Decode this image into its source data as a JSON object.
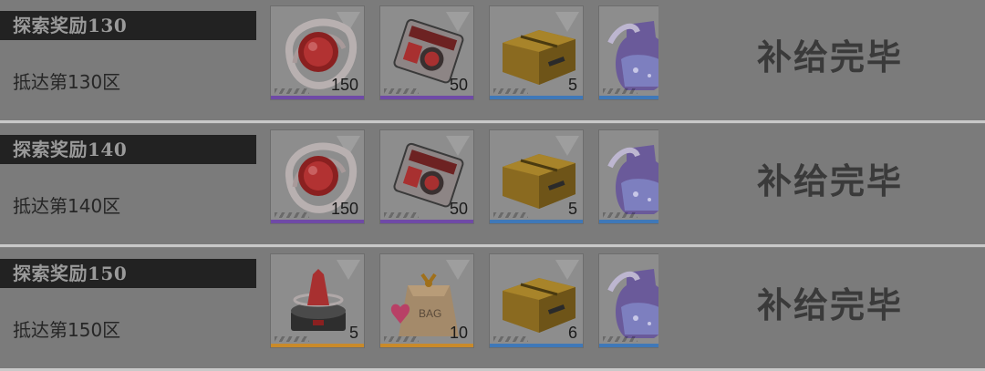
{
  "rows": [
    {
      "title": "探索奖励130",
      "subtitle": "抵达第130区",
      "status": "补给完毕",
      "items": [
        {
          "icon": "red-core-icon",
          "qty": "150",
          "rarity_color": "#6f4aa6"
        },
        {
          "icon": "red-device-icon",
          "qty": "50",
          "rarity_color": "#6f4aa6"
        },
        {
          "icon": "supply-crate-icon",
          "qty": "5",
          "rarity_color": "#3f78b8"
        },
        {
          "icon": "potion-bottle-icon",
          "qty": "",
          "rarity_color": "#3f78b8"
        }
      ]
    },
    {
      "title": "探索奖励140",
      "subtitle": "抵达第140区",
      "status": "补给完毕",
      "items": [
        {
          "icon": "red-core-icon",
          "qty": "150",
          "rarity_color": "#6f4aa6"
        },
        {
          "icon": "red-device-icon",
          "qty": "50",
          "rarity_color": "#6f4aa6"
        },
        {
          "icon": "supply-crate-icon",
          "qty": "5",
          "rarity_color": "#3f78b8"
        },
        {
          "icon": "potion-bottle-icon",
          "qty": "",
          "rarity_color": "#3f78b8"
        }
      ]
    },
    {
      "title": "探索奖励150",
      "subtitle": "抵达第150区",
      "status": "补给完毕",
      "items": [
        {
          "icon": "hologram-device-icon",
          "qty": "5",
          "rarity_color": "#c98a2a"
        },
        {
          "icon": "gift-bag-icon",
          "qty": "10",
          "rarity_color": "#c98a2a",
          "bag_text": "BAG"
        },
        {
          "icon": "supply-crate-icon",
          "qty": "6",
          "rarity_color": "#3f78b8"
        },
        {
          "icon": "potion-bottle-icon",
          "qty": "",
          "rarity_color": "#3f78b8"
        }
      ]
    }
  ]
}
